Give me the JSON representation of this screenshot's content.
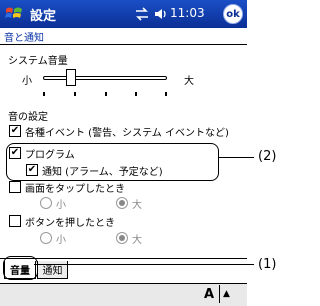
{
  "titlebar": {
    "app_title": "設定",
    "time": "11:03",
    "ok_label": "ok"
  },
  "page": {
    "header": "音と通知"
  },
  "volume": {
    "label": "システム音量",
    "min_label": "小",
    "max_label": "大",
    "level": 0.2
  },
  "sounds": {
    "section_label": "音の設定",
    "events": {
      "label": "各種イベント (警告、システム イベントなど)",
      "checked": true
    },
    "programs": {
      "label": "プログラム",
      "checked": true
    },
    "notifications": {
      "label": "通知 (アラーム、予定など)",
      "checked": true
    },
    "screen_tap": {
      "label": "画面をタップしたとき",
      "checked": false,
      "soft_label": "小",
      "loud_label": "大",
      "selected": "loud"
    },
    "button_press": {
      "label": "ボタンを押したとき",
      "checked": false,
      "soft_label": "小",
      "loud_label": "大",
      "selected": "loud"
    }
  },
  "tabs": [
    {
      "label": "音量"
    },
    {
      "label": "通知"
    }
  ],
  "callouts": {
    "one": "(1)",
    "two": "(2)"
  },
  "sip": {
    "input_label": "A",
    "arrow": "▲"
  }
}
